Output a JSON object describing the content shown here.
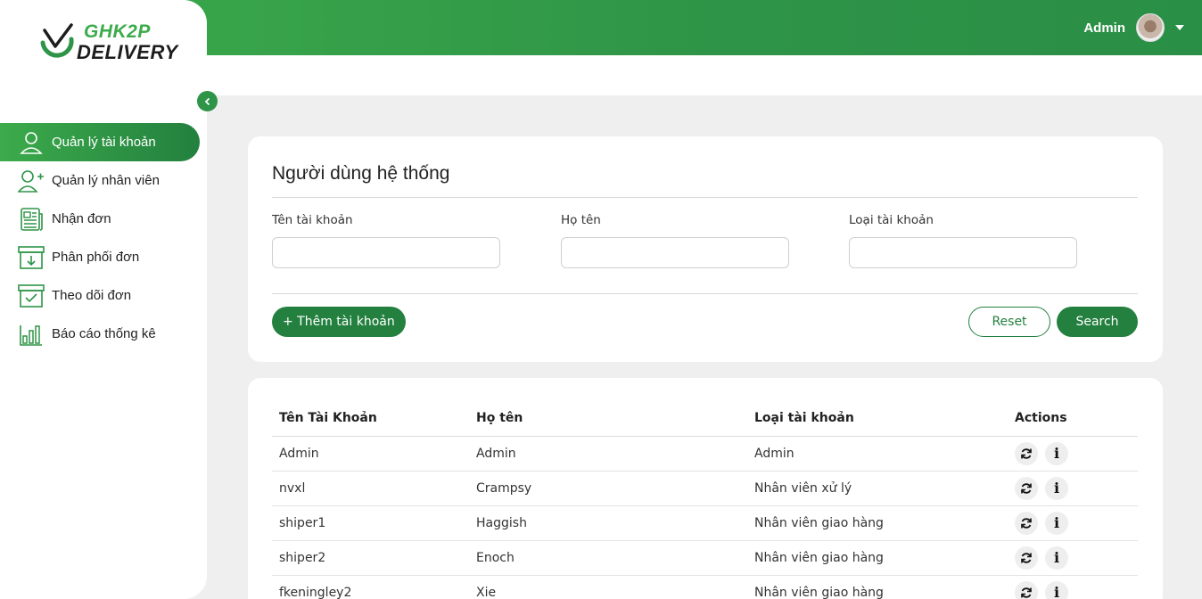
{
  "brand": {
    "line1": "GHK2P",
    "line2": "DELIVERY"
  },
  "header": {
    "user_name": "Admin"
  },
  "sidebar": {
    "items": [
      {
        "label": "Quản lý tài khoản",
        "icon": "user-icon",
        "active": true
      },
      {
        "label": "Quản lý nhân viên",
        "icon": "user-add-icon",
        "active": false
      },
      {
        "label": "Nhận đơn",
        "icon": "document-icon",
        "active": false
      },
      {
        "label": "Phân phối đơn",
        "icon": "archive-download-icon",
        "active": false
      },
      {
        "label": "Theo dõi đơn",
        "icon": "archive-check-icon",
        "active": false
      },
      {
        "label": "Báo cáo thống kê",
        "icon": "bar-chart-icon",
        "active": false
      }
    ]
  },
  "filter": {
    "title": "Người dùng hệ thống",
    "fields": [
      {
        "label": "Tên tài khoản",
        "value": ""
      },
      {
        "label": "Họ tên",
        "value": ""
      },
      {
        "label": "Loại tài khoản",
        "value": ""
      }
    ],
    "add_label": "+ Thêm tài khoản",
    "reset_label": "Reset",
    "search_label": "Search"
  },
  "table": {
    "headers": [
      "Tên Tài Khoản",
      "Họ tên",
      "Loại tài khoản",
      "Actions"
    ],
    "rows": [
      [
        "Admin",
        "Admin",
        "Admin"
      ],
      [
        "nvxl",
        "Crampsy",
        "Nhân viên xử lý"
      ],
      [
        "shiper1",
        "Haggish",
        "Nhân viên giao hàng"
      ],
      [
        "shiper2",
        "Enoch",
        "Nhân viên giao hàng"
      ],
      [
        "fkeningley2",
        "Xie",
        "Nhân viên giao hàng"
      ]
    ],
    "info_glyph": "i"
  },
  "colors": {
    "primary": "#23803f",
    "accent": "#3cab4b"
  }
}
